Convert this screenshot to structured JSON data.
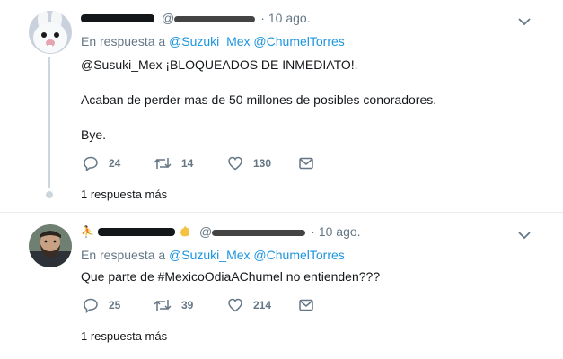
{
  "tweets": [
    {
      "time": "10 ago.",
      "reply_prefix": "En respuesta a",
      "reply_mentions": "@Suzuki_Mex @ChumelTorres",
      "lines": [
        "@Susuki_Mex ¡BLOQUEADOS DE INMEDIATO!.",
        "Acaban de perder mas de 50 millones de posibles conoradores.",
        "Bye."
      ],
      "replies": "24",
      "retweets": "14",
      "likes": "130",
      "more_replies": "1 respuesta más"
    },
    {
      "time": "10 ago.",
      "reply_prefix": "En respuesta a",
      "reply_mentions": "@Suzuki_Mex @ChumelTorres",
      "lines": [
        "Que parte de #MexicoOdiaAChumel no entienden???"
      ],
      "replies": "25",
      "retweets": "39",
      "likes": "214",
      "more_replies": "1 respuesta más"
    }
  ],
  "icons": {
    "reply": "reply-icon",
    "retweet": "retweet-icon",
    "like": "heart-icon",
    "dm": "envelope-icon",
    "caret": "chevron-down-icon",
    "verified_emoji": "hand-emoji-icon",
    "person": "person-emoji-icon"
  },
  "colors": {
    "text": "#14171a",
    "muted": "#657786",
    "link": "#1b95e0",
    "thread_line": "#ccd6dd",
    "divider": "#e6ecf0"
  }
}
